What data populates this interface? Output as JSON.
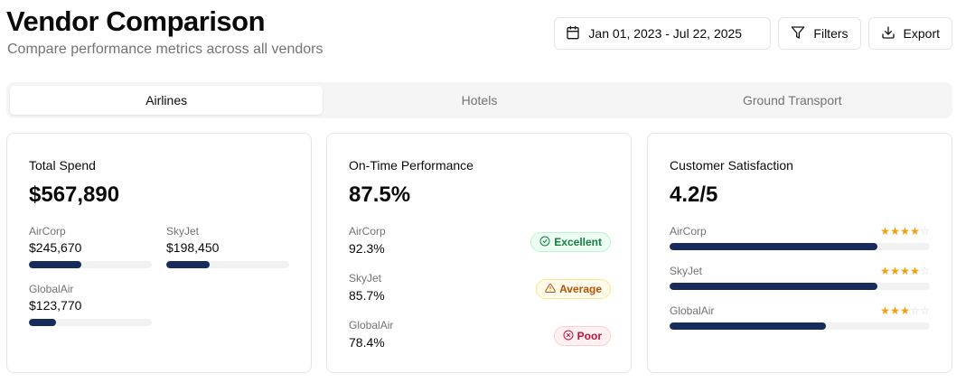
{
  "header": {
    "title": "Vendor Comparison",
    "subtitle": "Compare performance metrics across all vendors"
  },
  "toolbar": {
    "date_range": "Jan 01, 2023 - Jul 22, 2025",
    "filters_label": "Filters",
    "export_label": "Export",
    "icons": [
      "calendar-icon",
      "filter-icon",
      "download-icon"
    ]
  },
  "tabs": [
    {
      "label": "Airlines",
      "active": true
    },
    {
      "label": "Hotels",
      "active": false
    },
    {
      "label": "Ground Transport",
      "active": false
    }
  ],
  "total_spend": {
    "title": "Total Spend",
    "value": "$567,890",
    "bar_color": "#172b5c",
    "vendors": [
      {
        "name": "AirCorp",
        "amount": "$245,670",
        "fraction": 0.43
      },
      {
        "name": "SkyJet",
        "amount": "$198,450",
        "fraction": 0.35
      },
      {
        "name": "GlobalAir",
        "amount": "$123,770",
        "fraction": 0.22
      }
    ]
  },
  "on_time": {
    "title": "On-Time Performance",
    "value": "87.5%",
    "vendors": [
      {
        "name": "AirCorp",
        "value": "92.3%",
        "badge": "Excellent",
        "badge_icon": "check-circle-icon",
        "badge_color": "#15803d"
      },
      {
        "name": "SkyJet",
        "value": "85.7%",
        "badge": "Average",
        "badge_icon": "warning-triangle-icon",
        "badge_color": "#b45309"
      },
      {
        "name": "GlobalAir",
        "value": "78.4%",
        "badge": "Poor",
        "badge_icon": "x-circle-icon",
        "badge_color": "#be123c"
      }
    ]
  },
  "satisfaction": {
    "title": "Customer Satisfaction",
    "value": "4.2/5",
    "star_color": "#f59e0b",
    "vendors": [
      {
        "name": "AirCorp",
        "stars": 4,
        "fraction": 0.8
      },
      {
        "name": "SkyJet",
        "stars": 4,
        "fraction": 0.8
      },
      {
        "name": "GlobalAir",
        "stars": 3,
        "fraction": 0.6
      }
    ]
  }
}
